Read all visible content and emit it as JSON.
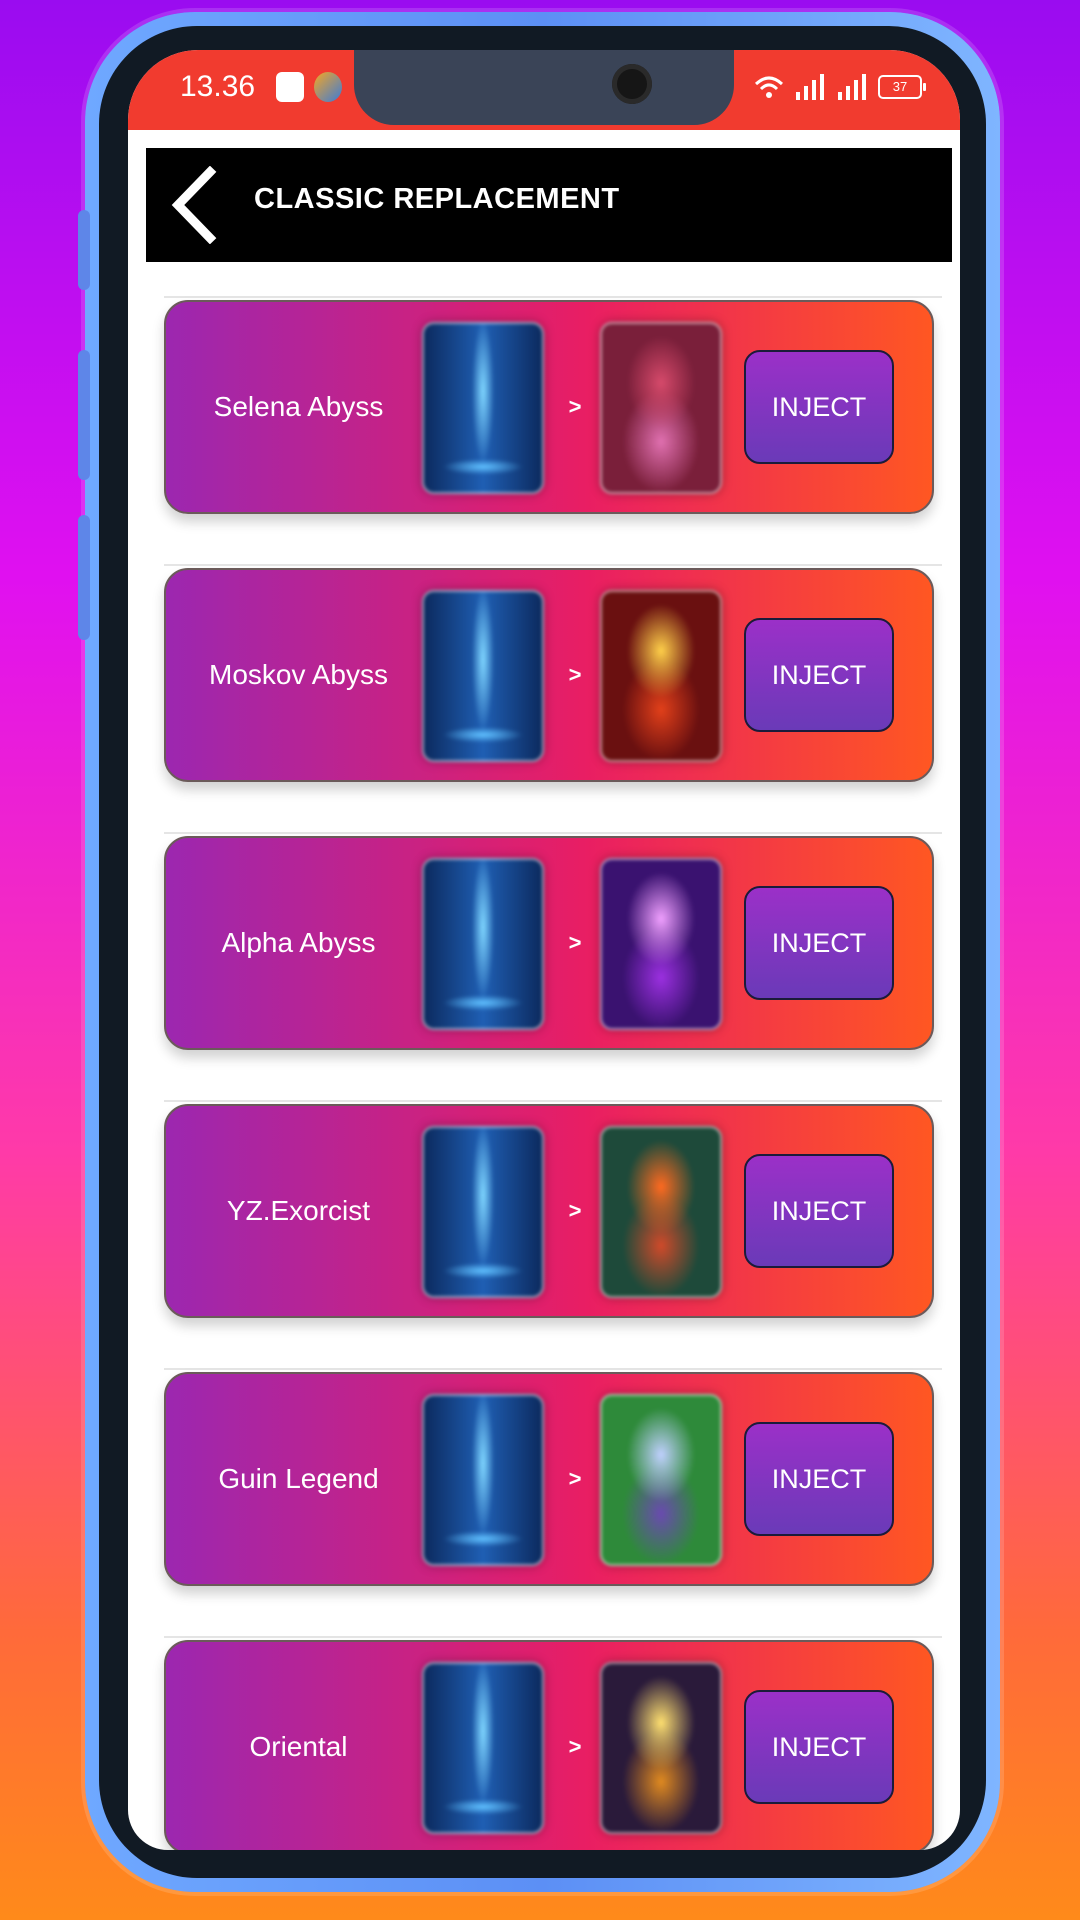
{
  "status_bar": {
    "time": "13.36",
    "battery": "37",
    "icons": [
      "tiktok-icon",
      "app-icon",
      "wifi-icon",
      "signal-icon",
      "signal-icon",
      "battery-icon"
    ]
  },
  "header": {
    "title": "CLASSIC REPLACEMENT",
    "back_icon": "back-arrow-icon"
  },
  "arrow_text": ">",
  "items": [
    {
      "name": "Selena Abyss",
      "button": "INJECT",
      "to_colors": [
        "#d64a6b",
        "#e070b0",
        "#7a1f3a"
      ]
    },
    {
      "name": "Moskov Abyss",
      "button": "INJECT",
      "to_colors": [
        "#ffd04a",
        "#e2401a",
        "#6a1010"
      ]
    },
    {
      "name": "Alpha Abyss",
      "button": "INJECT",
      "to_colors": [
        "#f0a0ff",
        "#9b30e0",
        "#3a1270"
      ]
    },
    {
      "name": "YZ.Exorcist",
      "button": "INJECT",
      "to_colors": [
        "#ff6a20",
        "#d04a2a",
        "#1e4a3a"
      ]
    },
    {
      "name": "Guin Legend",
      "button": "INJECT",
      "to_colors": [
        "#c0d0ff",
        "#6a4ab0",
        "#2e8a3a"
      ]
    },
    {
      "name": "Oriental",
      "button": "INJECT",
      "to_colors": [
        "#ffe070",
        "#e08a20",
        "#2a1a3a"
      ]
    }
  ]
}
